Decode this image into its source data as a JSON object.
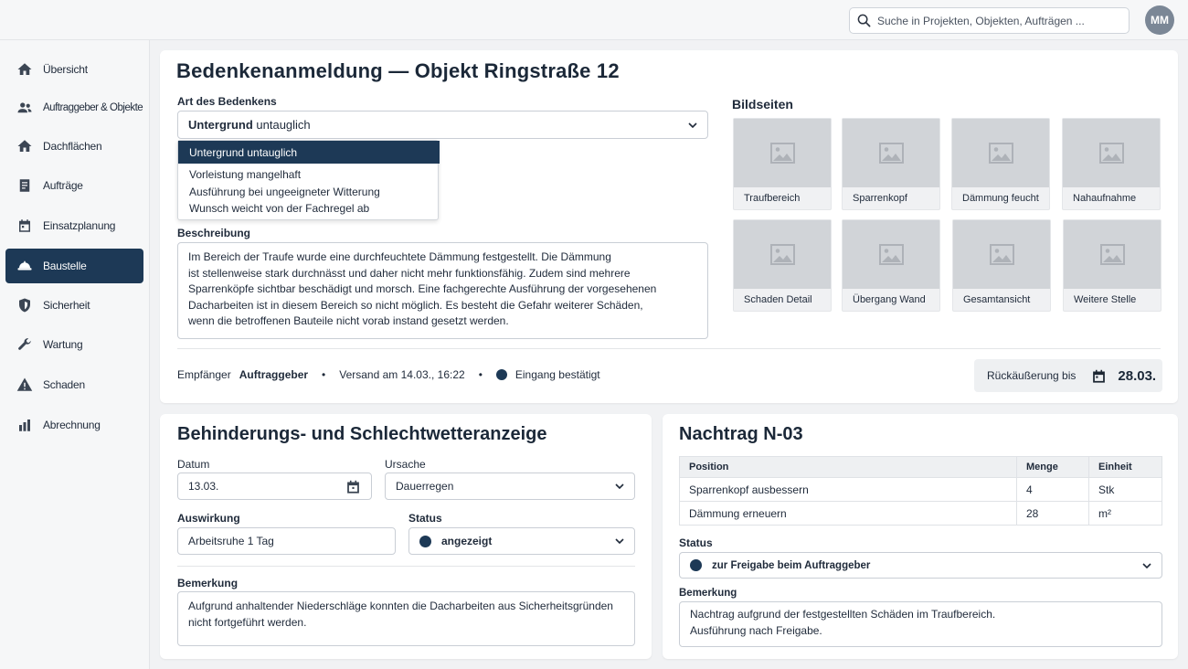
{
  "search": {
    "placeholder": "Suche in Projekten, Objekten, Aufträgen ..."
  },
  "user": {
    "initials": "MM"
  },
  "sidebar": {
    "items": [
      {
        "label": "Übersicht",
        "icon": "home-icon"
      },
      {
        "label": "Auftraggeber & Objekte",
        "icon": "users-icon"
      },
      {
        "label": "Dachflächen",
        "icon": "home-icon"
      },
      {
        "label": "Aufträge",
        "icon": "document-icon"
      },
      {
        "label": "Einsatzplanung",
        "icon": "calendar-icon"
      },
      {
        "label": "Baustelle",
        "icon": "hardhat-icon",
        "active": true
      },
      {
        "label": "Sicherheit",
        "icon": "shield-icon"
      },
      {
        "label": "Wartung",
        "icon": "wrench-icon"
      },
      {
        "label": "Schaden",
        "icon": "warning-icon"
      },
      {
        "label": "Abrechnung",
        "icon": "bar-chart-icon"
      }
    ]
  },
  "bedenken": {
    "title": "Bedenkenanmeldung — Objekt Ringstraße 12",
    "type_label": "Art des Bedenkens",
    "type_value_bold": "Untergrund",
    "type_value_rest": " untauglich",
    "options": [
      "Untergrund untauglich",
      "Vorleistung mangelhaft",
      "Ausführung bei ungeeigneter Witterung",
      "Wunsch weicht von der Fachregel ab"
    ],
    "description_label": "Beschreibung",
    "description_lines": [
      "Im Bereich der Traufe wurde eine durchfeuchtete Dämmung festgestellt. Die Dämmung",
      "ist stellenweise stark durchnässt und daher nicht mehr funktionsfähig. Zudem sind mehrere",
      "Sparrenköpfe sichtbar beschädigt und morsch. Eine fachgerechte Ausführung der vorgesehenen",
      "Dacharbeiten ist in diesem Bereich so nicht möglich. Es besteht die Gefahr weiterer Schäden,",
      "wenn die betroffenen Bauteile nicht vorab instand gesetzt werden."
    ],
    "images_label": "Bildseiten",
    "images": [
      "Traufbereich",
      "Sparrenkopf",
      "Dämmung feucht",
      "Nahaufnahme",
      "Schaden Detail",
      "Übergang Wand",
      "Gesamtansicht",
      "Weitere Stelle"
    ],
    "recipient_label": "Empfänger",
    "recipient_value": "Auftraggeber",
    "sent": "Versand am 14.03., 16:22",
    "receipt": "Eingang bestätigt",
    "reply_label": "Rückäußerung bis",
    "reply_date": "28.03."
  },
  "behinderung": {
    "title": "Behinderungs- und Schlechtwetteranzeige",
    "date_label": "Datum",
    "date_value": "13.03.",
    "cause_label": "Ursache",
    "cause_value": "Dauerregen",
    "effect_label": "Auswirkung",
    "effect_value": "Arbeitsruhe 1 Tag",
    "status_label": "Status",
    "status_value": "angezeigt",
    "remark_label": "Bemerkung",
    "remark_lines": [
      "Aufgrund anhaltender Niederschläge konnten die Dacharbeiten aus Sicherheitsgründen",
      "nicht fortgeführt werden."
    ]
  },
  "nachtrag": {
    "title": "Nachtrag N-03",
    "columns": [
      "Position",
      "Menge",
      "Einheit"
    ],
    "rows": [
      {
        "position": "Sparrenkopf ausbessern",
        "menge": "4",
        "einheit": "Stk"
      },
      {
        "position": "Dämmung erneuern",
        "menge": "28",
        "einheit": "m²"
      }
    ],
    "status_label": "Status",
    "status_value": "zur Freigabe beim Auftraggeber",
    "remark_label": "Bemerkung",
    "remark_lines": [
      "Nachtrag aufgrund der festgestellten Schäden im Traufbereich.",
      "Ausführung nach Freigabe."
    ]
  }
}
